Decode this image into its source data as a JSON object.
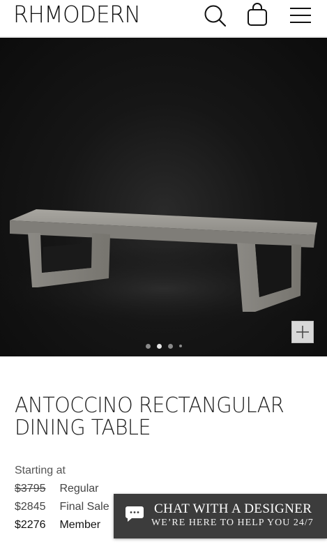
{
  "header": {
    "logo": "RHMODERN",
    "icons": [
      "search-icon",
      "shopping-bag-icon",
      "menu-icon"
    ]
  },
  "gallery": {
    "image": "rectangular-dining-table-photo",
    "slide_count": 4,
    "active_slide": 2,
    "zoom_icon": "plus-icon"
  },
  "product": {
    "title": "ANTOCCINO RECTANGULAR DINING TABLE",
    "starting_label": "Starting at",
    "prices": [
      {
        "amount": "$3795",
        "label": "Regular",
        "strikethrough": true
      },
      {
        "amount": "$2845",
        "label": "Final Sale",
        "strikethrough": false
      },
      {
        "amount": "$2276",
        "label": "Member",
        "strikethrough": false
      }
    ]
  },
  "chat": {
    "icon": "chat-bubble-icon",
    "title": "CHAT WITH A DESIGNER",
    "subtitle": "WE’RE HERE TO HELP YOU 24/7"
  },
  "colors": {
    "hero_background": "#111111",
    "chat_background": "#3c3c3c",
    "text": "#222222"
  }
}
